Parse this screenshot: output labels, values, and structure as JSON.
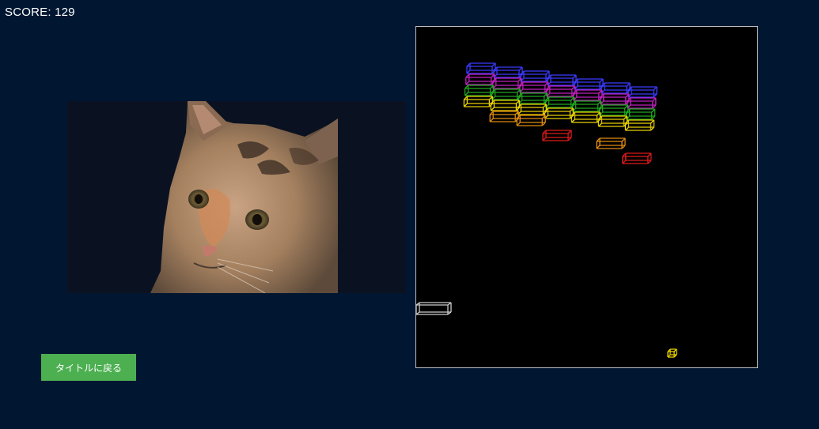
{
  "score": {
    "label": "SCORE:",
    "value": 129
  },
  "webcam": {
    "subject": "cat-face",
    "colors": {
      "background": "#0a1221",
      "fur": "#b08a6e"
    }
  },
  "back_button": {
    "label": "タイトルに戻る",
    "color": "#4caf50"
  },
  "game": {
    "background": "#000000",
    "border_color": "#b9bec6",
    "bricks": [
      {
        "row": 0,
        "col": 0,
        "color": "#3b3bff"
      },
      {
        "row": 0,
        "col": 1,
        "color": "#3b3bff"
      },
      {
        "row": 0,
        "col": 2,
        "color": "#3b3bff"
      },
      {
        "row": 0,
        "col": 3,
        "color": "#3b3bff"
      },
      {
        "row": 0,
        "col": 4,
        "color": "#3b3bff"
      },
      {
        "row": 0,
        "col": 5,
        "color": "#3b3bff"
      },
      {
        "row": 0,
        "col": 6,
        "color": "#3b3bff"
      },
      {
        "row": 1,
        "col": 0,
        "color": "#c020c0"
      },
      {
        "row": 1,
        "col": 1,
        "color": "#c020c0"
      },
      {
        "row": 1,
        "col": 2,
        "color": "#c020c0"
      },
      {
        "row": 1,
        "col": 3,
        "color": "#c020c0"
      },
      {
        "row": 1,
        "col": 4,
        "color": "#c020c0"
      },
      {
        "row": 1,
        "col": 5,
        "color": "#c020c0"
      },
      {
        "row": 1,
        "col": 6,
        "color": "#c020c0"
      },
      {
        "row": 2,
        "col": 0,
        "color": "#1fa81f"
      },
      {
        "row": 2,
        "col": 1,
        "color": "#1fa81f"
      },
      {
        "row": 2,
        "col": 2,
        "color": "#1fa81f"
      },
      {
        "row": 2,
        "col": 3,
        "color": "#1fa81f"
      },
      {
        "row": 2,
        "col": 4,
        "color": "#1fa81f"
      },
      {
        "row": 2,
        "col": 5,
        "color": "#1fa81f"
      },
      {
        "row": 2,
        "col": 6,
        "color": "#1fa81f"
      },
      {
        "row": 3,
        "col": 0,
        "color": "#e8d000"
      },
      {
        "row": 3,
        "col": 1,
        "color": "#e8d000"
      },
      {
        "row": 3,
        "col": 2,
        "color": "#e8d000"
      },
      {
        "row": 3,
        "col": 3,
        "color": "#e8d000"
      },
      {
        "row": 3,
        "col": 4,
        "color": "#e8d000"
      },
      {
        "row": 3,
        "col": 5,
        "color": "#e8d000"
      },
      {
        "row": 3,
        "col": 6,
        "color": "#e8d000"
      },
      {
        "row": 4,
        "col": 1,
        "color": "#e08a10"
      },
      {
        "row": 4,
        "col": 2,
        "color": "#e08a10"
      },
      {
        "row": 5,
        "col": 3,
        "color": "#e01a1a"
      },
      {
        "row": 5,
        "col": 5,
        "color": "#e08a10"
      },
      {
        "row": 6,
        "col": 6,
        "color": "#e01a1a"
      }
    ],
    "paddle_color": "#cccccc",
    "ball_color": "#e8d000"
  }
}
